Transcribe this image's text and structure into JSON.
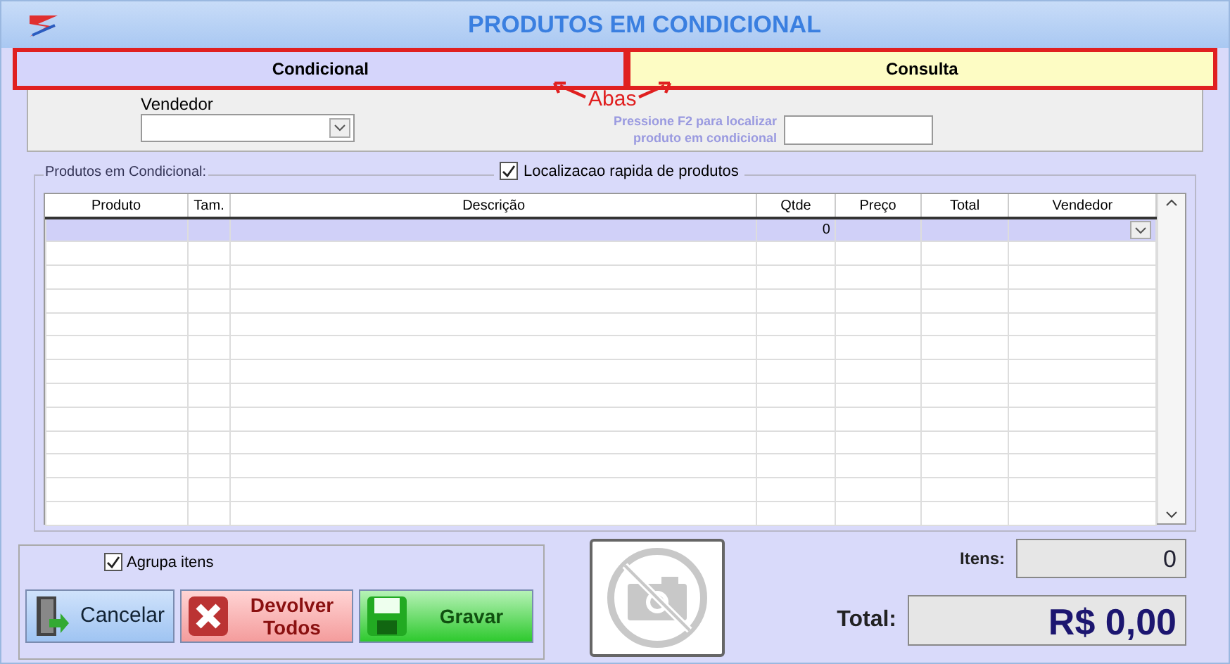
{
  "window": {
    "title": "PRODUTOS EM CONDICIONAL"
  },
  "tabs": [
    {
      "label": "Condicional",
      "selected": true
    },
    {
      "label": "Consulta",
      "selected": false
    }
  ],
  "annotation": {
    "label": "Abas"
  },
  "filter": {
    "vendedor_label": "Vendedor",
    "hint": "Pressione F2 para localizar produto em condicional"
  },
  "group": {
    "title": "Produtos em Condicional:",
    "quick_search": {
      "label": "Localizacao rapida de produtos",
      "checked": true
    }
  },
  "table": {
    "columns": [
      "Produto",
      "Tam.",
      "Descrição",
      "Qtde",
      "Preço",
      "Total",
      "Vendedor"
    ],
    "rows": [
      {
        "selected": true,
        "cells": [
          "",
          "",
          "",
          "0",
          "",
          "",
          ""
        ]
      }
    ]
  },
  "group_items": {
    "label": "Agrupa itens",
    "checked": true
  },
  "buttons": [
    {
      "kind": "cancel",
      "label": "Cancelar"
    },
    {
      "kind": "return",
      "label": "Devolver Todos"
    },
    {
      "kind": "save",
      "label": "Gravar"
    }
  ],
  "itens": {
    "label": "Itens:",
    "value": "0"
  },
  "total": {
    "label": "Total:",
    "value": "R$ 0,00"
  }
}
